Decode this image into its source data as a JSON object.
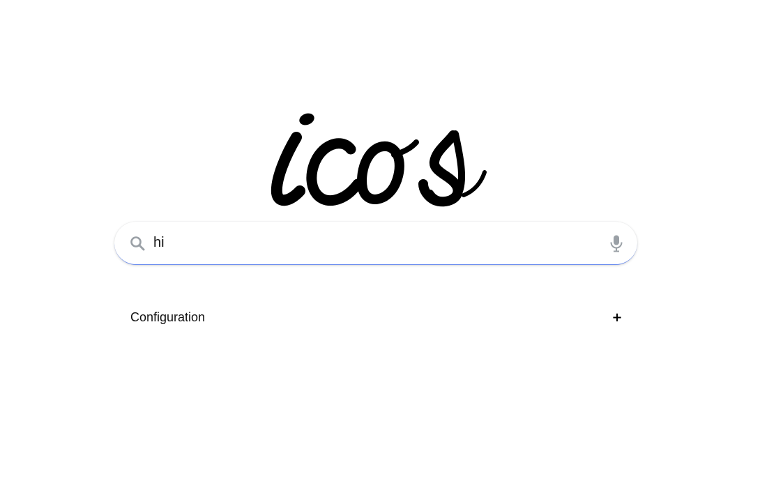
{
  "logo": {
    "text": "icos"
  },
  "search": {
    "value": "hi",
    "placeholder": "",
    "icon": "search-icon",
    "voice_icon": "mic-icon"
  },
  "configuration": {
    "label": "Configuration",
    "toggle_symbol": "+"
  },
  "colors": {
    "search_underline": "#6c8ef0",
    "icon_gray": "#9aa0a6"
  }
}
